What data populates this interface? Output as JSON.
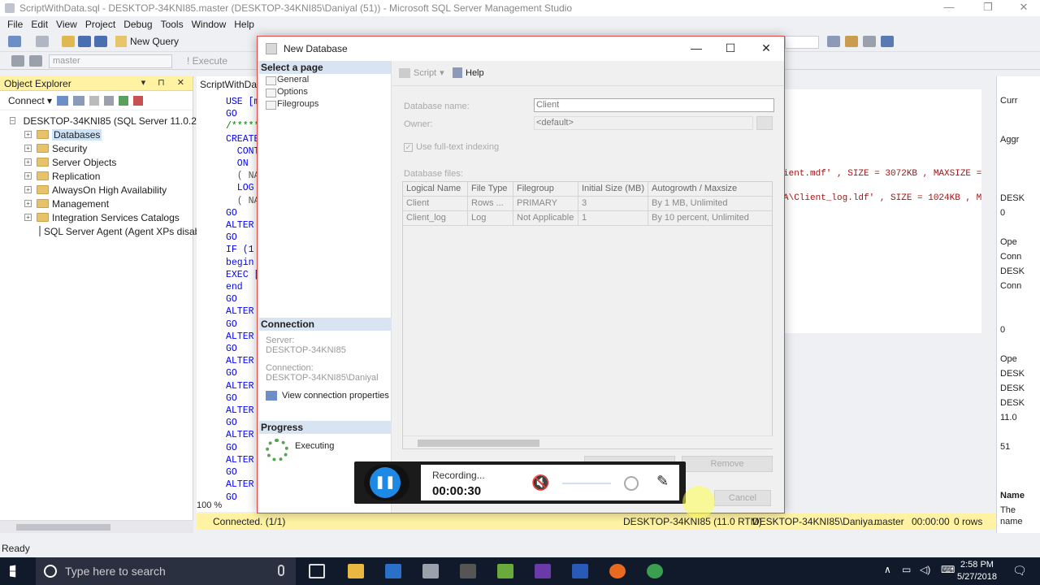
{
  "window": {
    "title": "ScriptWithData.sql - DESKTOP-34KNI85.master (DESKTOP-34KNI85\\Daniyal (51)) - Microsoft SQL Server Management Studio"
  },
  "menu": [
    "File",
    "Edit",
    "View",
    "Project",
    "Debug",
    "Tools",
    "Window",
    "Help"
  ],
  "toolbar": {
    "new_query": "New Query",
    "database": "master",
    "execute": "Execute"
  },
  "object_explorer": {
    "title": "Object Explorer",
    "connect": "Connect",
    "server": "DESKTOP-34KNI85 (SQL Server 11.0.21",
    "items": [
      "Databases",
      "Security",
      "Server Objects",
      "Replication",
      "AlwaysOn High Availability",
      "Management",
      "Integration Services Catalogs",
      "SQL Server Agent (Agent XPs disab"
    ]
  },
  "editor": {
    "tab": "ScriptWithData",
    "zoom": "100 %",
    "lines": [
      "USE [m",
      "GO",
      "/*****",
      "CREATE",
      "  CONTA",
      "  ON  P",
      "  ( NAME",
      "  LOG O",
      "  ( NAME",
      "GO",
      "ALTER",
      "GO",
      "IF (1",
      "begin",
      "EXEC [",
      "end",
      "GO",
      "ALTER",
      "GO",
      "ALTER",
      "GO",
      "ALTER",
      "GO",
      "ALTER",
      "GO",
      "ALTER",
      "GO",
      "ALTER",
      "GO",
      "ALTER",
      "GO",
      "ALTER",
      "GO"
    ],
    "right_line1": "ient.mdf' , SIZE = 3072KB , MAXSIZE =",
    "right_line2": "A\\Client_log.ldf' , SIZE = 1024KB , M"
  },
  "properties": [
    "Curr",
    "Aggr",
    "DESK",
    "0",
    "Ope",
    "Conn",
    "DESK",
    "Conn",
    "0",
    "Ope",
    "DESK",
    "DESK",
    "DESK",
    "11.0",
    "51",
    "Name",
    "The",
    "name"
  ],
  "dialog": {
    "title": "New Database",
    "select_page": "Select a page",
    "pages": [
      "General",
      "Options",
      "Filegroups"
    ],
    "connection_head": "Connection",
    "server_lbl": "Server:",
    "server_val": "DESKTOP-34KNI85",
    "connection_lbl": "Connection:",
    "connection_val": "DESKTOP-34KNI85\\Daniyal",
    "view_props": "View connection properties",
    "progress_head": "Progress",
    "progress_val": "Executing",
    "script": "Script",
    "help": "Help",
    "db_name_lbl": "Database name:",
    "db_name_val": "Client",
    "owner_lbl": "Owner:",
    "owner_val": "<default>",
    "fulltext": "Use full-text indexing",
    "files_lbl": "Database files:",
    "columns": [
      "Logical Name",
      "File Type",
      "Filegroup",
      "Initial Size (MB)",
      "Autogrowth / Maxsize"
    ],
    "rows": [
      [
        "Client",
        "Rows ...",
        "PRIMARY",
        "3",
        "By 1 MB, Unlimited"
      ],
      [
        "Client_log",
        "Log",
        "Not Applicable",
        "1",
        "By 10 percent, Unlimited"
      ]
    ],
    "remove": "Remove",
    "cancel": "Cancel"
  },
  "recorder": {
    "label": "Recording...",
    "time": "00:00:30"
  },
  "status": {
    "connected": "Connected. (1/1)",
    "server": "DESKTOP-34KNI85 (11.0 RTM)",
    "user": "DESKTOP-34KNI85\\Daniya...",
    "db": "master",
    "elapsed": "00:00:00",
    "rows": "0 rows"
  },
  "ready": "Ready",
  "taskbar": {
    "search": "Type here to search",
    "time": "2:58 PM",
    "date": "5/27/2018"
  }
}
